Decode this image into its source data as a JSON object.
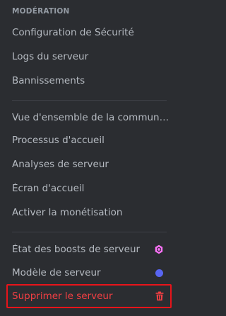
{
  "section": {
    "header": "MODÉRATION"
  },
  "moderation_items": [
    {
      "label": "Configuration de Sécurité"
    },
    {
      "label": "Logs du serveur"
    },
    {
      "label": "Bannissements"
    }
  ],
  "community_items": [
    {
      "label": "Vue d'ensemble de la communauté"
    },
    {
      "label": "Processus d'accueil"
    },
    {
      "label": "Analyses de serveur"
    },
    {
      "label": "Écran d'accueil"
    },
    {
      "label": "Activer la monétisation"
    }
  ],
  "server_items": [
    {
      "label": "État des boosts de serveur",
      "icon": "boost-gem-icon",
      "icon_color": "#ff73fa"
    },
    {
      "label": "Modèle de serveur",
      "icon": "status-dot-icon",
      "icon_color": "#5865f2"
    }
  ],
  "danger_item": {
    "label": "Supprimer le serveur",
    "icon": "trash-icon",
    "color": "#f23f43",
    "highlight_color": "#e8141a"
  },
  "colors": {
    "background": "#2b2d31",
    "text": "#b5bac1",
    "header": "#949ba4",
    "divider": "#3f4147"
  }
}
